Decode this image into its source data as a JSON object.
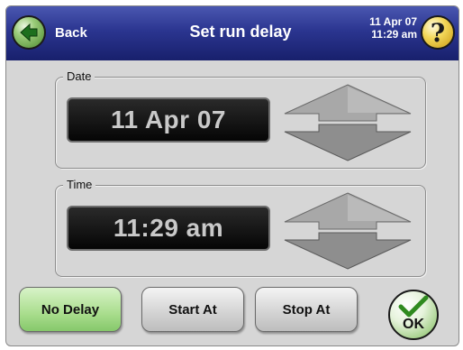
{
  "header": {
    "back_label": "Back",
    "title": "Set run delay",
    "date": "11 Apr 07",
    "time": "11:29 am",
    "help_glyph": "?"
  },
  "date_group": {
    "legend": "Date",
    "value": "11 Apr 07"
  },
  "time_group": {
    "legend": "Time",
    "value": "11:29 am"
  },
  "buttons": {
    "no_delay": "No Delay",
    "start_at": "Start At",
    "stop_at": "Stop At",
    "ok": "OK"
  },
  "colors": {
    "header": "#2b3590",
    "selected_button": "#a9dd8d",
    "display_bg": "#0a0a0a",
    "display_text": "#c9c9c9"
  },
  "icons": [
    "back-arrow-icon",
    "help-icon",
    "arrow-up-icon",
    "arrow-down-icon",
    "checkmark-icon"
  ]
}
